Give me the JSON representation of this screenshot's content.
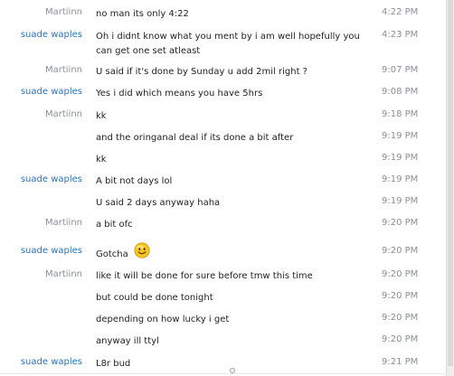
{
  "conversation": [
    {
      "sender": "Martiinn",
      "sender_class": "martiinn",
      "text": "no man its only 4:22",
      "time": "4:22 PM"
    },
    {
      "sender": "suade waples",
      "sender_class": "suade",
      "text": "Oh i didnt know what you ment by i am well hopefully you can get one set atleast",
      "time": "4:23 PM"
    },
    {
      "sender": "Martiinn",
      "sender_class": "martiinn",
      "text": "U said if it's done by Sunday u add 2mil right ?",
      "time": "9:07 PM"
    },
    {
      "sender": "suade waples",
      "sender_class": "suade",
      "text": "Yes i did which means you have 5hrs",
      "time": "9:08 PM"
    },
    {
      "sender": "Martiinn",
      "sender_class": "martiinn",
      "text": "kk",
      "time": "9:18 PM"
    },
    {
      "sender": "",
      "sender_class": "martiinn",
      "text": "and the oringanal deal if its done a bit after",
      "time": "9:19 PM"
    },
    {
      "sender": "",
      "sender_class": "martiinn",
      "text": "kk",
      "time": "9:19 PM"
    },
    {
      "sender": "suade waples",
      "sender_class": "suade",
      "text": "A bit not days lol",
      "time": "9:19 PM"
    },
    {
      "sender": "",
      "sender_class": "suade",
      "text": "U said 2 days anyway haha",
      "time": "9:19 PM"
    },
    {
      "sender": "Martiinn",
      "sender_class": "martiinn",
      "text": "a bit ofc",
      "time": "9:20 PM"
    },
    {
      "sender": "suade waples",
      "sender_class": "suade",
      "text": "Gotcha",
      "time": "9:20 PM",
      "emoticon": "smiley-face-icon"
    },
    {
      "sender": "Martiinn",
      "sender_class": "martiinn",
      "text": "like it will be done for sure before tmw this time",
      "time": "9:20 PM"
    },
    {
      "sender": "",
      "sender_class": "martiinn",
      "text": "but could be done tonight",
      "time": "9:20 PM"
    },
    {
      "sender": "",
      "sender_class": "martiinn",
      "text": "depending on how lucky i get",
      "time": "9:20 PM"
    },
    {
      "sender": "",
      "sender_class": "martiinn",
      "text": "anyway ill ttyl",
      "time": "9:20 PM"
    },
    {
      "sender": "suade waples",
      "sender_class": "suade",
      "text": "L8r bud",
      "time": "9:21 PM"
    }
  ],
  "colors": {
    "sender_martiinn": "#8a8f96",
    "sender_suade": "#1f74c3",
    "message_text": "#222222",
    "timestamp": "#8a8f96",
    "smiley_fill": "#f7c51c"
  }
}
